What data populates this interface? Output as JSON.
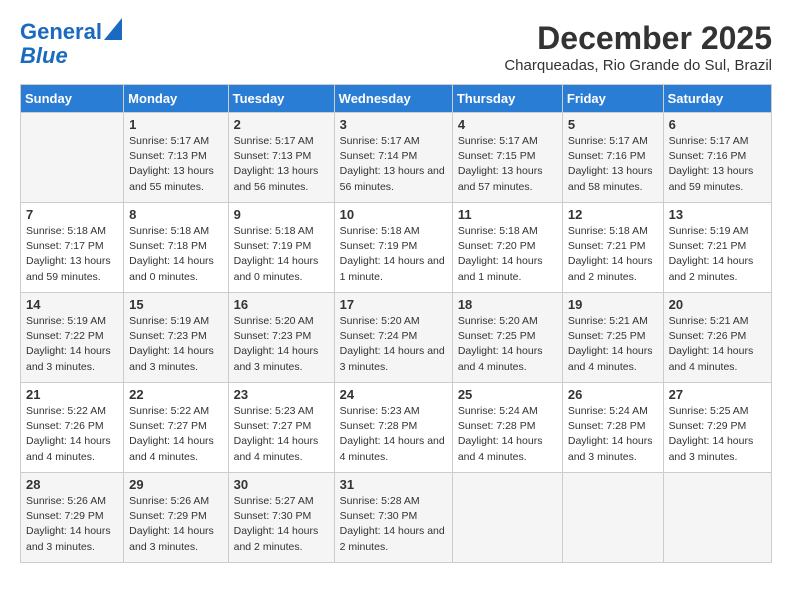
{
  "logo": {
    "line1": "General",
    "line2": "Blue"
  },
  "title": "December 2025",
  "location": "Charqueadas, Rio Grande do Sul, Brazil",
  "headers": [
    "Sunday",
    "Monday",
    "Tuesday",
    "Wednesday",
    "Thursday",
    "Friday",
    "Saturday"
  ],
  "weeks": [
    [
      {
        "day": "",
        "sunrise": "",
        "sunset": "",
        "daylight": ""
      },
      {
        "day": "1",
        "sunrise": "Sunrise: 5:17 AM",
        "sunset": "Sunset: 7:13 PM",
        "daylight": "Daylight: 13 hours and 55 minutes."
      },
      {
        "day": "2",
        "sunrise": "Sunrise: 5:17 AM",
        "sunset": "Sunset: 7:13 PM",
        "daylight": "Daylight: 13 hours and 56 minutes."
      },
      {
        "day": "3",
        "sunrise": "Sunrise: 5:17 AM",
        "sunset": "Sunset: 7:14 PM",
        "daylight": "Daylight: 13 hours and 56 minutes."
      },
      {
        "day": "4",
        "sunrise": "Sunrise: 5:17 AM",
        "sunset": "Sunset: 7:15 PM",
        "daylight": "Daylight: 13 hours and 57 minutes."
      },
      {
        "day": "5",
        "sunrise": "Sunrise: 5:17 AM",
        "sunset": "Sunset: 7:16 PM",
        "daylight": "Daylight: 13 hours and 58 minutes."
      },
      {
        "day": "6",
        "sunrise": "Sunrise: 5:17 AM",
        "sunset": "Sunset: 7:16 PM",
        "daylight": "Daylight: 13 hours and 59 minutes."
      }
    ],
    [
      {
        "day": "7",
        "sunrise": "Sunrise: 5:18 AM",
        "sunset": "Sunset: 7:17 PM",
        "daylight": "Daylight: 13 hours and 59 minutes."
      },
      {
        "day": "8",
        "sunrise": "Sunrise: 5:18 AM",
        "sunset": "Sunset: 7:18 PM",
        "daylight": "Daylight: 14 hours and 0 minutes."
      },
      {
        "day": "9",
        "sunrise": "Sunrise: 5:18 AM",
        "sunset": "Sunset: 7:19 PM",
        "daylight": "Daylight: 14 hours and 0 minutes."
      },
      {
        "day": "10",
        "sunrise": "Sunrise: 5:18 AM",
        "sunset": "Sunset: 7:19 PM",
        "daylight": "Daylight: 14 hours and 1 minute."
      },
      {
        "day": "11",
        "sunrise": "Sunrise: 5:18 AM",
        "sunset": "Sunset: 7:20 PM",
        "daylight": "Daylight: 14 hours and 1 minute."
      },
      {
        "day": "12",
        "sunrise": "Sunrise: 5:18 AM",
        "sunset": "Sunset: 7:21 PM",
        "daylight": "Daylight: 14 hours and 2 minutes."
      },
      {
        "day": "13",
        "sunrise": "Sunrise: 5:19 AM",
        "sunset": "Sunset: 7:21 PM",
        "daylight": "Daylight: 14 hours and 2 minutes."
      }
    ],
    [
      {
        "day": "14",
        "sunrise": "Sunrise: 5:19 AM",
        "sunset": "Sunset: 7:22 PM",
        "daylight": "Daylight: 14 hours and 3 minutes."
      },
      {
        "day": "15",
        "sunrise": "Sunrise: 5:19 AM",
        "sunset": "Sunset: 7:23 PM",
        "daylight": "Daylight: 14 hours and 3 minutes."
      },
      {
        "day": "16",
        "sunrise": "Sunrise: 5:20 AM",
        "sunset": "Sunset: 7:23 PM",
        "daylight": "Daylight: 14 hours and 3 minutes."
      },
      {
        "day": "17",
        "sunrise": "Sunrise: 5:20 AM",
        "sunset": "Sunset: 7:24 PM",
        "daylight": "Daylight: 14 hours and 3 minutes."
      },
      {
        "day": "18",
        "sunrise": "Sunrise: 5:20 AM",
        "sunset": "Sunset: 7:25 PM",
        "daylight": "Daylight: 14 hours and 4 minutes."
      },
      {
        "day": "19",
        "sunrise": "Sunrise: 5:21 AM",
        "sunset": "Sunset: 7:25 PM",
        "daylight": "Daylight: 14 hours and 4 minutes."
      },
      {
        "day": "20",
        "sunrise": "Sunrise: 5:21 AM",
        "sunset": "Sunset: 7:26 PM",
        "daylight": "Daylight: 14 hours and 4 minutes."
      }
    ],
    [
      {
        "day": "21",
        "sunrise": "Sunrise: 5:22 AM",
        "sunset": "Sunset: 7:26 PM",
        "daylight": "Daylight: 14 hours and 4 minutes."
      },
      {
        "day": "22",
        "sunrise": "Sunrise: 5:22 AM",
        "sunset": "Sunset: 7:27 PM",
        "daylight": "Daylight: 14 hours and 4 minutes."
      },
      {
        "day": "23",
        "sunrise": "Sunrise: 5:23 AM",
        "sunset": "Sunset: 7:27 PM",
        "daylight": "Daylight: 14 hours and 4 minutes."
      },
      {
        "day": "24",
        "sunrise": "Sunrise: 5:23 AM",
        "sunset": "Sunset: 7:28 PM",
        "daylight": "Daylight: 14 hours and 4 minutes."
      },
      {
        "day": "25",
        "sunrise": "Sunrise: 5:24 AM",
        "sunset": "Sunset: 7:28 PM",
        "daylight": "Daylight: 14 hours and 4 minutes."
      },
      {
        "day": "26",
        "sunrise": "Sunrise: 5:24 AM",
        "sunset": "Sunset: 7:28 PM",
        "daylight": "Daylight: 14 hours and 3 minutes."
      },
      {
        "day": "27",
        "sunrise": "Sunrise: 5:25 AM",
        "sunset": "Sunset: 7:29 PM",
        "daylight": "Daylight: 14 hours and 3 minutes."
      }
    ],
    [
      {
        "day": "28",
        "sunrise": "Sunrise: 5:26 AM",
        "sunset": "Sunset: 7:29 PM",
        "daylight": "Daylight: 14 hours and 3 minutes."
      },
      {
        "day": "29",
        "sunrise": "Sunrise: 5:26 AM",
        "sunset": "Sunset: 7:29 PM",
        "daylight": "Daylight: 14 hours and 3 minutes."
      },
      {
        "day": "30",
        "sunrise": "Sunrise: 5:27 AM",
        "sunset": "Sunset: 7:30 PM",
        "daylight": "Daylight: 14 hours and 2 minutes."
      },
      {
        "day": "31",
        "sunrise": "Sunrise: 5:28 AM",
        "sunset": "Sunset: 7:30 PM",
        "daylight": "Daylight: 14 hours and 2 minutes."
      },
      {
        "day": "",
        "sunrise": "",
        "sunset": "",
        "daylight": ""
      },
      {
        "day": "",
        "sunrise": "",
        "sunset": "",
        "daylight": ""
      },
      {
        "day": "",
        "sunrise": "",
        "sunset": "",
        "daylight": ""
      }
    ]
  ]
}
